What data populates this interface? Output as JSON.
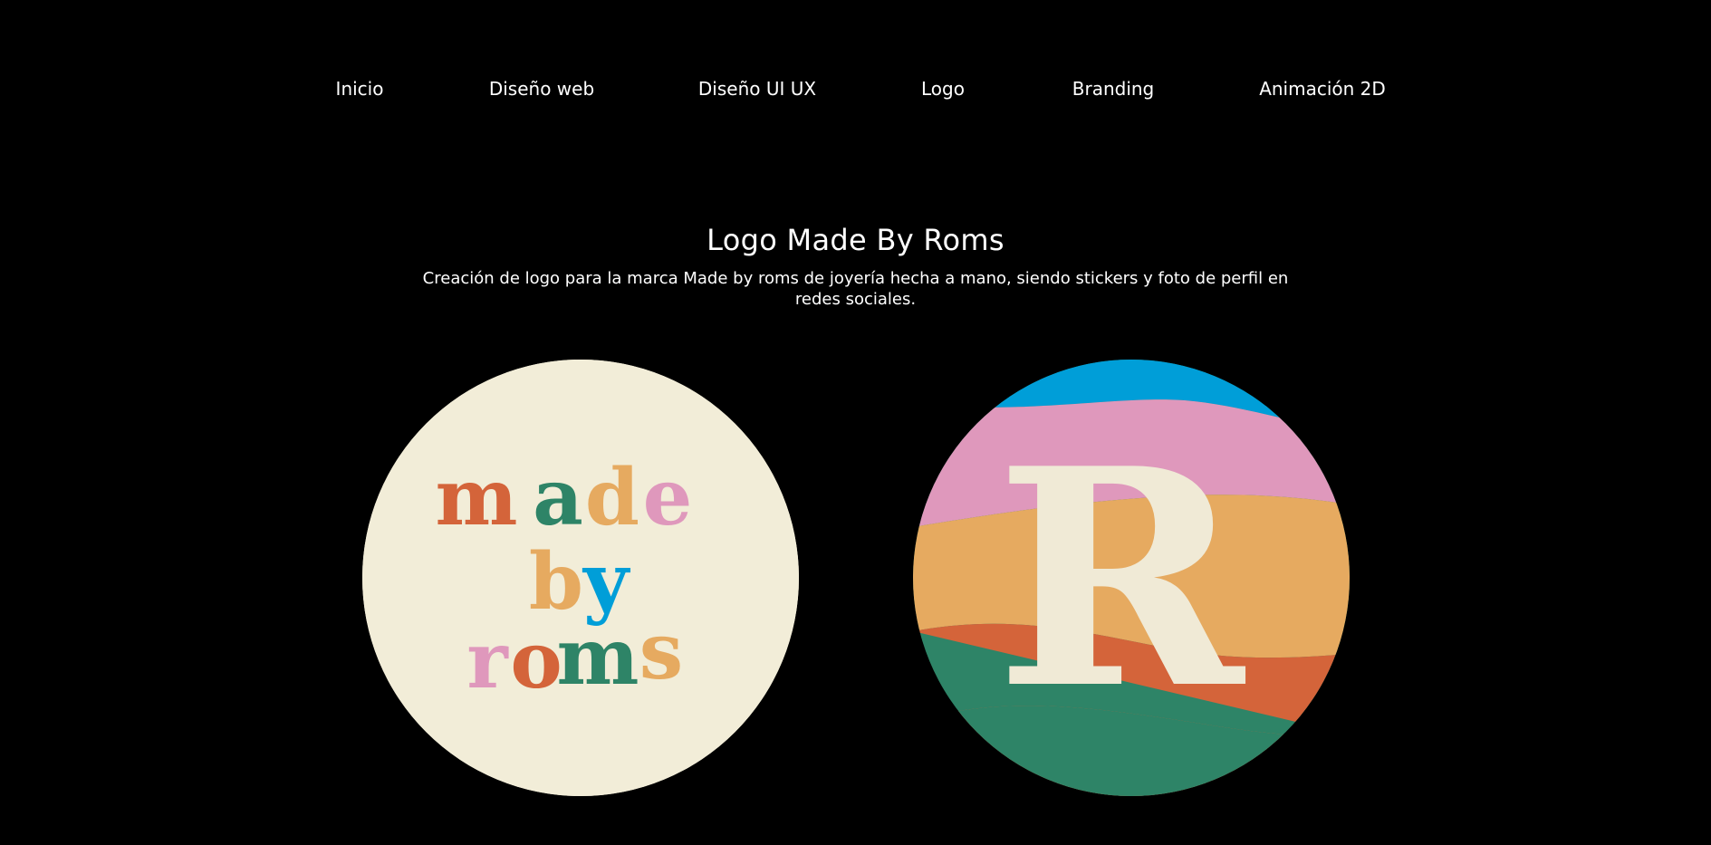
{
  "nav": {
    "items": [
      {
        "label": "Inicio"
      },
      {
        "label": "Diseño web"
      },
      {
        "label": "Diseño UI UX"
      },
      {
        "label": "Logo"
      },
      {
        "label": "Branding"
      },
      {
        "label": "Animación 2D"
      }
    ]
  },
  "project": {
    "title": "Logo Made By Roms",
    "description": "Creación de logo para la marca Made by roms de joyería hecha a mano, siendo stickers y foto de perfil en redes sociales."
  },
  "logos": {
    "wordmark": {
      "line1": [
        "m",
        "a",
        "d",
        "e"
      ],
      "line2": [
        "b",
        "y"
      ],
      "line3": [
        "r",
        "o",
        "m",
        "s"
      ]
    },
    "monogram": {
      "letter": "R"
    }
  },
  "colors": {
    "background": "#000000",
    "text": "#ffffff",
    "cream": "#f2edd8",
    "orange": "#d4643a",
    "green": "#2e8467",
    "sand": "#e6aa60",
    "pink": "#df98bc",
    "blue": "#009ed8"
  }
}
